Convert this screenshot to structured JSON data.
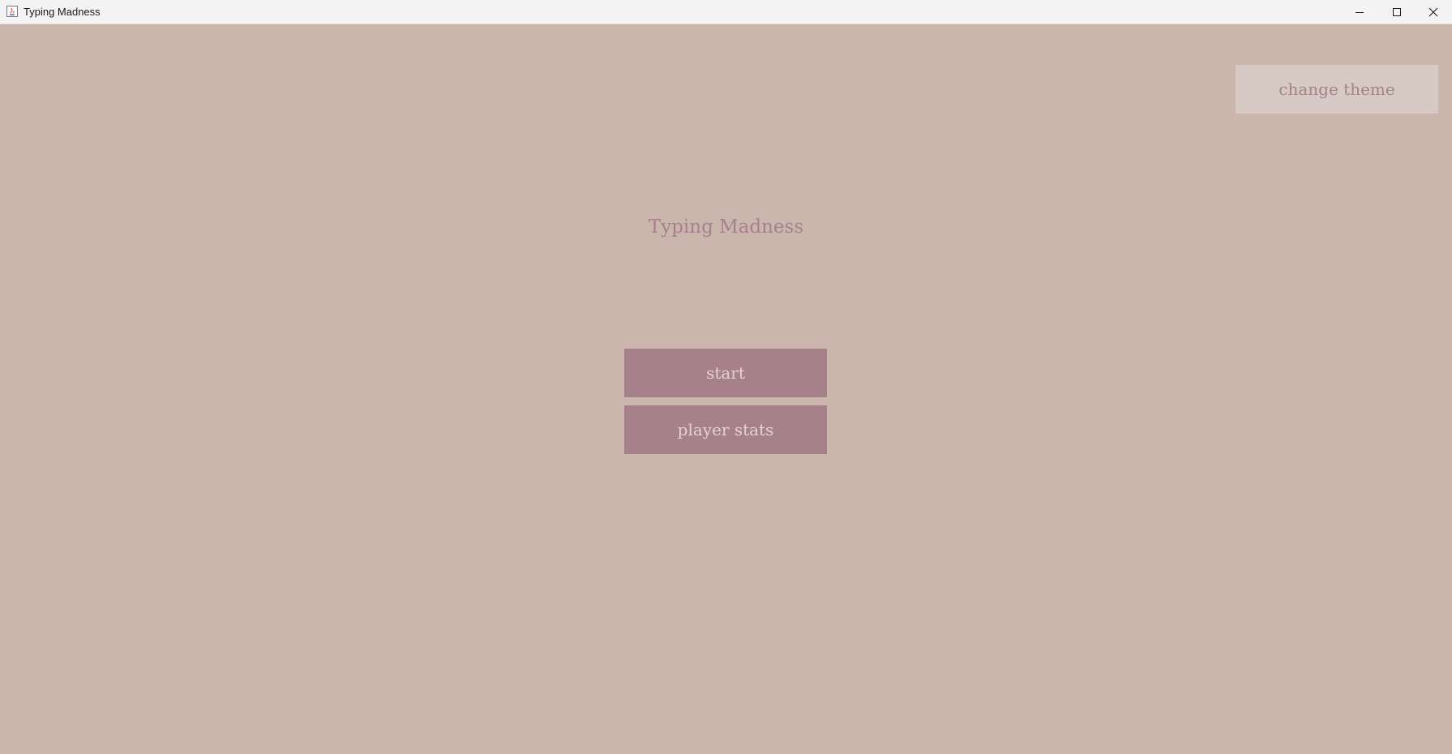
{
  "window": {
    "title": "Typing Madness",
    "controls": [
      "minimize-icon",
      "maximize-icon",
      "close-icon"
    ]
  },
  "main": {
    "title": "Typing Madness",
    "start_label": "start",
    "stats_label": "player stats",
    "theme_label": "change theme"
  },
  "colors": {
    "background": "#cbb6ae",
    "accent": "#a6808b",
    "button_text": "#e3d4d1",
    "theme_button_bg": "#d7c9c4",
    "titlebar": "#f3f3f3"
  }
}
